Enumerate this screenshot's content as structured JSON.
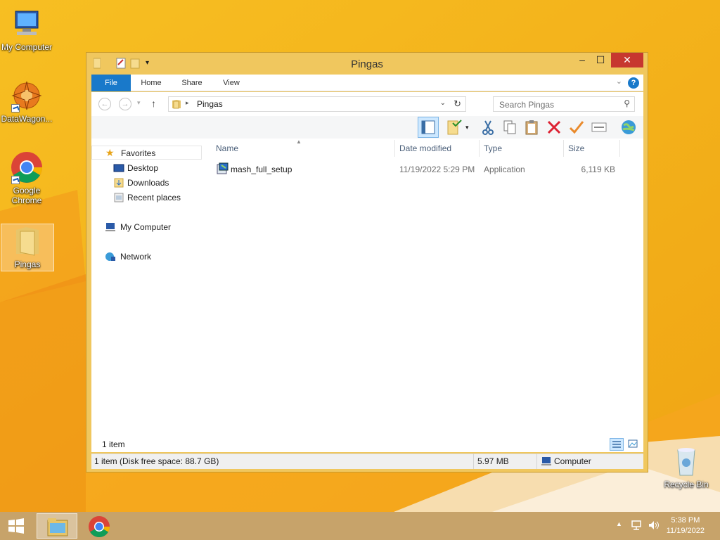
{
  "desktop": {
    "icons": [
      {
        "label": "My Computer"
      },
      {
        "label": "DataWagon..."
      },
      {
        "label": "Google Chrome"
      },
      {
        "label": "Pingas"
      },
      {
        "label": "Recycle Bin"
      }
    ]
  },
  "window": {
    "title": "Pingas",
    "ribbon": {
      "tabs": [
        "File",
        "Home",
        "Share",
        "View"
      ]
    },
    "address": {
      "path": "Pingas"
    },
    "search": {
      "placeholder": "Search Pingas"
    },
    "nav": {
      "favorites": "Favorites",
      "desktop": "Desktop",
      "downloads": "Downloads",
      "recent": "Recent places",
      "computer": "My Computer",
      "network": "Network"
    },
    "columns": [
      "Name",
      "Date modified",
      "Type",
      "Size"
    ],
    "files": [
      {
        "name": "mash_full_setup",
        "date": "11/19/2022 5:29 PM",
        "type": "Application",
        "size": "6,119 KB"
      }
    ],
    "item_count": "1 item",
    "status": {
      "left": "1 item (Disk free space: 88.7 GB)",
      "size": "5.97 MB",
      "location": "Computer"
    }
  },
  "taskbar": {
    "time": "5:38 PM",
    "date": "11/19/2022"
  },
  "colors": {
    "accent": "#1979ca",
    "close": "#c7372f",
    "window_frame": "#f0c75e"
  }
}
